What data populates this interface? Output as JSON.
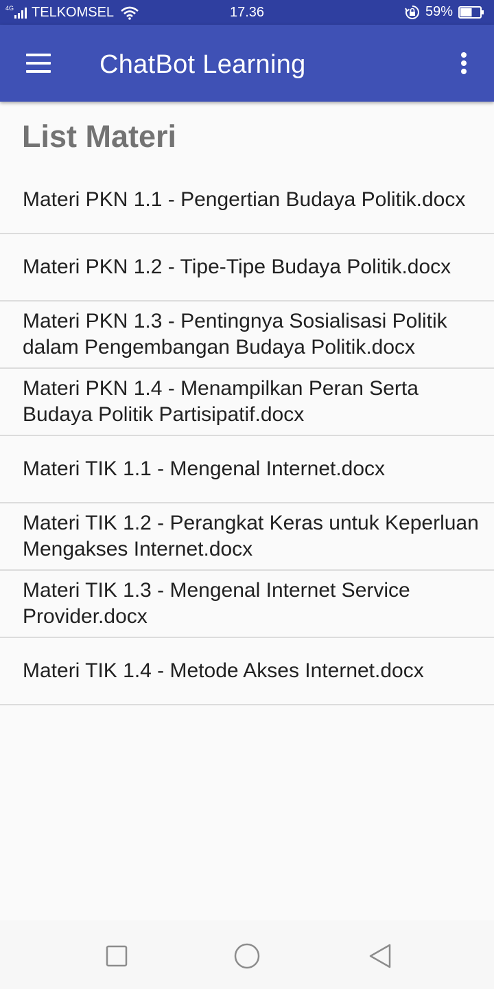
{
  "status_bar": {
    "network": "4G",
    "carrier": "TELKOMSEL",
    "time": "17.36",
    "battery_percent": "59%",
    "battery_level": 0.59,
    "icons": [
      "signal-icon",
      "wifi-icon",
      "rotation-lock-icon",
      "battery-icon"
    ]
  },
  "app_bar": {
    "title": "ChatBot Learning",
    "menu_icon": "hamburger-menu-icon",
    "overflow_icon": "more-vert-icon",
    "color": "#3f51b5"
  },
  "page": {
    "heading": "List Materi",
    "items": [
      {
        "label": "Materi PKN 1.1 - Pengertian Budaya Politik.docx"
      },
      {
        "label": "Materi PKN 1.2 - Tipe-Tipe Budaya Politik.docx"
      },
      {
        "label": "Materi PKN 1.3 - Pentingnya Sosialisasi Politik dalam Pengembangan Budaya Politik.docx"
      },
      {
        "label": "Materi PKN 1.4 - Menampilkan Peran Serta Budaya Politik Partisipatif.docx"
      },
      {
        "label": "Materi TIK 1.1 - Mengenal Internet.docx"
      },
      {
        "label": "Materi TIK 1.2 - Perangkat Keras untuk Keperluan Mengakses Internet.docx"
      },
      {
        "label": "Materi TIK 1.3 - Mengenal Internet Service Provider.docx"
      },
      {
        "label": "Materi TIK 1.4 - Metode Akses Internet.docx"
      }
    ]
  },
  "nav_bar": {
    "icons": [
      "recents-square-icon",
      "home-circle-icon",
      "back-triangle-icon"
    ]
  }
}
